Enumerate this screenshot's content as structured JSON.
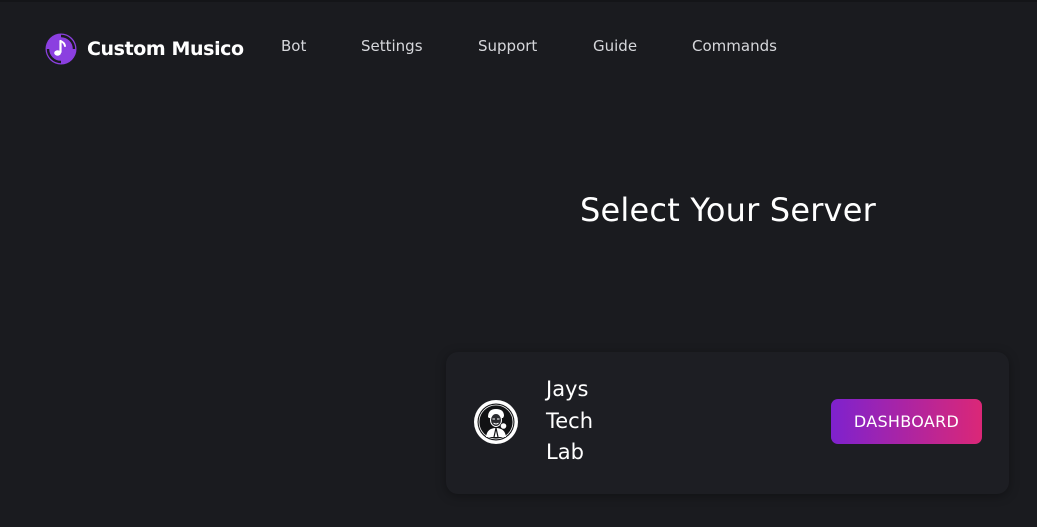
{
  "brand": {
    "name": "Custom Musico",
    "logo_icon": "music-note-icon",
    "accent_color": "#8b3fe0"
  },
  "nav": {
    "links": [
      "Bot",
      "Settings",
      "Support",
      "Guide",
      "Commands"
    ]
  },
  "page": {
    "title": "Select Your Server"
  },
  "servers": [
    {
      "name": "Jays Tech Lab",
      "avatar_icon": "server-avatar-icon",
      "action_label": "DASHBOARD",
      "action_gradient": [
        "#7e22ce",
        "#db2777"
      ]
    }
  ]
}
